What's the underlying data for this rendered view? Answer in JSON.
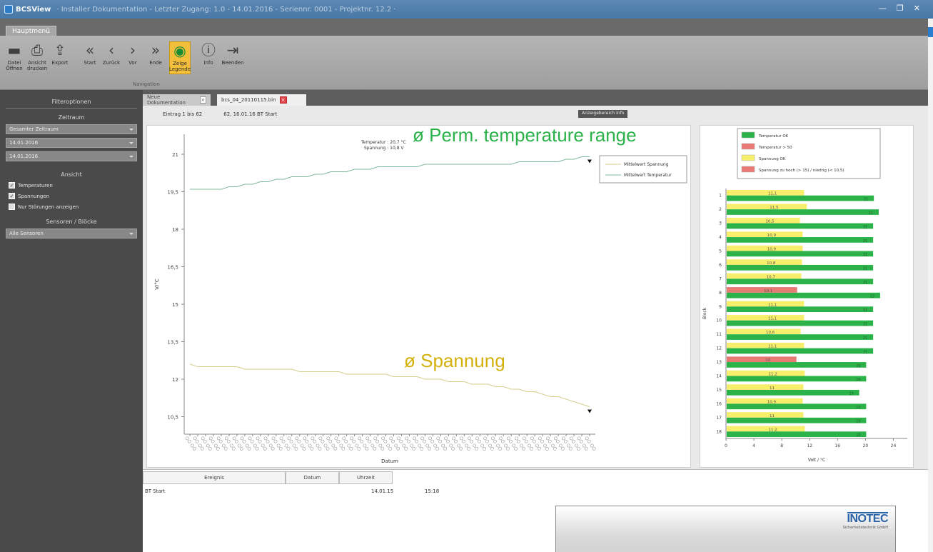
{
  "window": {
    "title": "BCSView",
    "path": "· Installer Dokumentation - Letzter Zugang: 1.0 - 14.01.2016 - Seriennr. 0001 - Projektnr. 12.2 ·",
    "controls": [
      "—",
      "❐",
      "✕"
    ]
  },
  "ribbon": {
    "tab": "Hauptmenü",
    "buttons": [
      {
        "id": "open",
        "icon": "folder-icon",
        "glyph": "▬",
        "label": "Datei Öffnen"
      },
      {
        "id": "print",
        "icon": "printer-icon",
        "glyph": "⎙",
        "label": "Ansicht drucken"
      },
      {
        "id": "export",
        "icon": "export-icon",
        "glyph": "⇪",
        "label": "Export"
      },
      {
        "id": "start",
        "icon": "double-left-icon",
        "glyph": "«",
        "label": "Start"
      },
      {
        "id": "back",
        "icon": "left-icon",
        "glyph": "‹",
        "label": "Zurück"
      },
      {
        "id": "forward",
        "icon": "right-icon",
        "glyph": "›",
        "label": "Vor"
      },
      {
        "id": "end",
        "icon": "double-right-icon",
        "glyph": "»",
        "label": "Ende"
      },
      {
        "id": "legend",
        "icon": "legend-icon",
        "glyph": "◉",
        "label": "Zeige Legende"
      },
      {
        "id": "info",
        "icon": "info-icon",
        "glyph": "ⓘ",
        "label": "Info"
      },
      {
        "id": "exit",
        "icon": "exit-icon",
        "glyph": "⇥",
        "label": "Beenden"
      }
    ],
    "group_label": "Navigation"
  },
  "sidebar": {
    "header": "Filteroptionen",
    "period_label": "Zeitraum",
    "period_select": "Gesamter Zeitraum",
    "date_from": "14.01.2016",
    "date_to": "14.01.2016",
    "view_label": "Ansicht",
    "checks": [
      {
        "label": "Temperaturen",
        "checked": true
      },
      {
        "label": "Spannungen",
        "checked": true
      },
      {
        "label": "Nur Störungen anzeigen",
        "checked": false
      }
    ],
    "sensors_label": "Sensoren / Blöcke",
    "sensors_select": "Alle Sensoren"
  },
  "doc_tabs": [
    {
      "label": "Neue Dokumentation",
      "active": false
    },
    {
      "label": "bcs_04_20110115.bin",
      "active": true
    }
  ],
  "info_bar": {
    "entry": "Eintrag 1 bis 62",
    "range": "62, 16.01.16  BT Start",
    "button": "Anzeigebereich Info"
  },
  "annotations": {
    "temperature": "ø Perm. temperature range",
    "voltage": "ø Spannung",
    "temperature_color": "#2bb34a",
    "voltage_color": "#d4b00a"
  },
  "chart_data": [
    {
      "type": "line",
      "xlabel": "Datum",
      "ylabel": "V/°C",
      "y_ticks": [
        "21",
        "19,5",
        "18",
        "16,5",
        "15",
        "13,5",
        "12",
        "10,5"
      ],
      "ylim": [
        9.8,
        21.8
      ],
      "tooltip": [
        "Temperatur : 20,7 °C",
        "Spannung : 10,8 V"
      ],
      "legend": [
        "Mittelwert Spannung",
        "Mittelwert Temperatur"
      ],
      "series": [
        {
          "name": "Mittelwert Temperatur",
          "color": "#7fb89a",
          "values": [
            19.6,
            19.6,
            19.6,
            19.6,
            19.6,
            19.7,
            19.7,
            19.8,
            19.8,
            19.9,
            19.9,
            20.0,
            20.0,
            20.1,
            20.1,
            20.1,
            20.2,
            20.2,
            20.3,
            20.3,
            20.3,
            20.4,
            20.4,
            20.4,
            20.5,
            20.5,
            20.5,
            20.5,
            20.5,
            20.5,
            20.6,
            20.6,
            20.6,
            20.6,
            20.6,
            20.6,
            20.6,
            20.6,
            20.6,
            20.6,
            20.6,
            20.6,
            20.7,
            20.7,
            20.7,
            20.7,
            20.7,
            20.7,
            20.8,
            20.8,
            20.9,
            20.9
          ]
        },
        {
          "name": "Mittelwert Spannung",
          "color": "#d4cf8c",
          "values": [
            12.6,
            12.5,
            12.5,
            12.5,
            12.5,
            12.5,
            12.5,
            12.4,
            12.4,
            12.4,
            12.4,
            12.4,
            12.4,
            12.4,
            12.3,
            12.3,
            12.3,
            12.3,
            12.3,
            12.3,
            12.2,
            12.2,
            12.2,
            12.2,
            12.2,
            12.2,
            12.1,
            12.1,
            12.1,
            12.1,
            12.0,
            12.0,
            12.0,
            11.9,
            11.9,
            11.9,
            11.8,
            11.8,
            11.8,
            11.7,
            11.7,
            11.6,
            11.6,
            11.5,
            11.5,
            11.4,
            11.3,
            11.3,
            11.2,
            11.1,
            11.0,
            10.9
          ]
        }
      ],
      "x_tick_count": 52
    },
    {
      "type": "bar",
      "orientation": "horizontal",
      "xlabel": "Volt / °C",
      "ylabel": "Block",
      "x_ticks": [
        0,
        4,
        8,
        12,
        16,
        20,
        24
      ],
      "xlim": [
        0,
        26
      ],
      "categories": [
        "1",
        "2",
        "3",
        "4",
        "5",
        "6",
        "7",
        "8",
        "9",
        "10",
        "11",
        "12",
        "13",
        "14",
        "15",
        "16",
        "17",
        "18"
      ],
      "legend": [
        {
          "label": "Temperatur OK",
          "color": "#2bb34a"
        },
        {
          "label": "Temperatur > 50",
          "color": "#e87a74"
        },
        {
          "label": "Spannung OK",
          "color": "#f7ef6c"
        },
        {
          "label": "Spannung zu hoch (> 15) / niedrig (< 10,5)",
          "color": "#e87a74"
        }
      ],
      "series": [
        {
          "name": "Temperatur",
          "values": [
            21.1,
            21.8,
            21.0,
            21.0,
            21.0,
            21.0,
            21.0,
            22.0,
            21.0,
            21.0,
            21.0,
            21.0,
            20.0,
            20.0,
            19.0,
            20.0,
            20.0,
            20.0
          ],
          "labels": [
            "21",
            "21",
            "21",
            "21",
            "21",
            "21",
            "21",
            "22",
            "21",
            "21",
            "21",
            "21",
            "20",
            "20",
            "19",
            "20",
            "20",
            "20"
          ]
        },
        {
          "name": "Spannung",
          "values": [
            11.1,
            11.5,
            10.5,
            10.9,
            10.9,
            10.8,
            10.7,
            10.1,
            11.1,
            11.1,
            10.6,
            11.1,
            10.0,
            11.2,
            11.0,
            10.9,
            11.0,
            11.2
          ],
          "labels": [
            "11,1",
            "11,5",
            "10,5",
            "10,9",
            "10,9",
            "10,8",
            "10,7",
            "10,1",
            "11,1",
            "11,1",
            "10,6",
            "11,1",
            "10",
            "11,2",
            "11",
            "10,9",
            "11",
            "11,2"
          ],
          "alert": [
            false,
            false,
            false,
            false,
            false,
            false,
            false,
            true,
            false,
            false,
            false,
            false,
            true,
            false,
            false,
            false,
            false,
            false
          ]
        }
      ]
    }
  ],
  "event_grid": {
    "headers": [
      "Ereignis",
      "Datum",
      "Uhrzeit"
    ],
    "rows": [
      {
        "event": "BT Start",
        "date": "14.01.15",
        "time": "15:18"
      }
    ]
  },
  "brand": {
    "logo": "INOTEC",
    "sub": "Sicherheitstechnik GmbH"
  }
}
